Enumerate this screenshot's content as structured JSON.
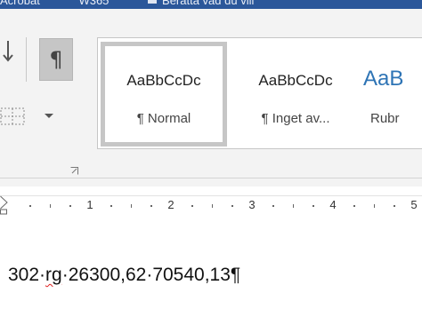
{
  "titlebar": {
    "text_left": "Acrobat",
    "text_mid": "W365",
    "text_right": "Beratta vad du vill"
  },
  "ribbon": {
    "paragraph_mark_glyph": "¶",
    "styles": [
      {
        "sample": "AaBbCcDc",
        "name": "¶ Normal",
        "selected": true
      },
      {
        "sample": "AaBbCcDc",
        "name": "¶ Inget av..."
      },
      {
        "sample": "AaB",
        "name": "Rubr"
      }
    ]
  },
  "ruler": {
    "numbers": [
      "1",
      "2",
      "3",
      "4",
      "5"
    ]
  },
  "document": {
    "part1": "302",
    "part2": "rg",
    "part3": "26300,62",
    "part4": "70540,13",
    "end_mark": "¶",
    "separator": "·"
  },
  "colors": {
    "title_bar": "#2b579a",
    "ribbon_bg": "#f3f3f3",
    "heading_blue": "#2e74b5",
    "spell_error": "#e02020"
  }
}
